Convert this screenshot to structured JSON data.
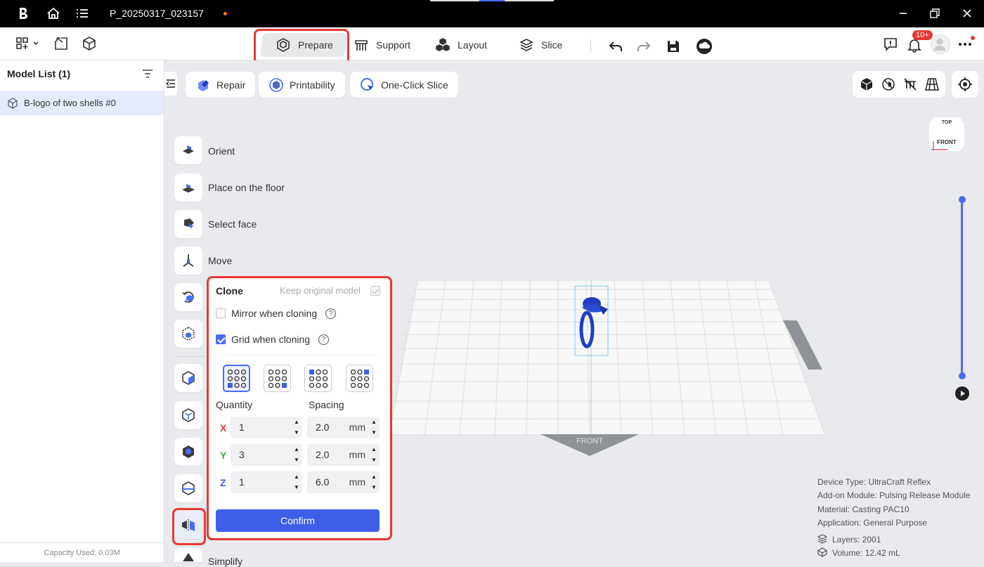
{
  "app": {
    "title": "P_20250317_023157"
  },
  "tabs": [
    {
      "label": "Prepare",
      "icon": "prepare-icon"
    },
    {
      "label": "Support",
      "icon": "support-icon"
    },
    {
      "label": "Layout",
      "icon": "layout-icon"
    },
    {
      "label": "Slice",
      "icon": "slice-icon"
    }
  ],
  "notifications": {
    "badge": "10+"
  },
  "sidebar": {
    "title": "Model List (1)",
    "items": [
      {
        "label": "B-logo of two shells #0"
      }
    ],
    "capacity": "Capacity Used: 0.03M"
  },
  "tools": {
    "repair": "Repair",
    "printability": "Printability",
    "one_click_slice": "One-Click Slice"
  },
  "left_tools": {
    "orient": "Orient",
    "place_floor": "Place on the floor",
    "select_face": "Select face",
    "move": "Move",
    "simplify": "Simplify"
  },
  "clone": {
    "title": "Clone",
    "keep_original": "Keep original model",
    "keep_original_checked": true,
    "mirror": "Mirror when cloning",
    "mirror_checked": false,
    "grid": "Grid when cloning",
    "grid_checked": true,
    "quantity_label": "Quantity",
    "spacing_label": "Spacing",
    "unit": "mm",
    "rows": [
      {
        "axis": "X",
        "quantity": "1",
        "spacing": "2.0",
        "color": "#e53935"
      },
      {
        "axis": "Y",
        "quantity": "3",
        "spacing": "2.0",
        "color": "#43a047"
      },
      {
        "axis": "Z",
        "quantity": "1",
        "spacing": "6.0",
        "color": "#3f5ee8"
      }
    ],
    "confirm": "Confirm"
  },
  "viewport": {
    "front_label": "FRONT",
    "cube_top": "TOP",
    "cube_front": "FRONT"
  },
  "info": {
    "device": "Device Type:  UltraCraft Reflex",
    "addon": "Add-on Module:  Pulsing Release Module",
    "material": "Material:  Casting PAC10",
    "application": "Application:  General Purpose",
    "layers": "Layers: 2001",
    "volume": "Volume: 12.42 mL"
  },
  "colors": {
    "accent": "#3f5ee8",
    "highlight": "#e53935",
    "model": "#1f3fbf"
  }
}
